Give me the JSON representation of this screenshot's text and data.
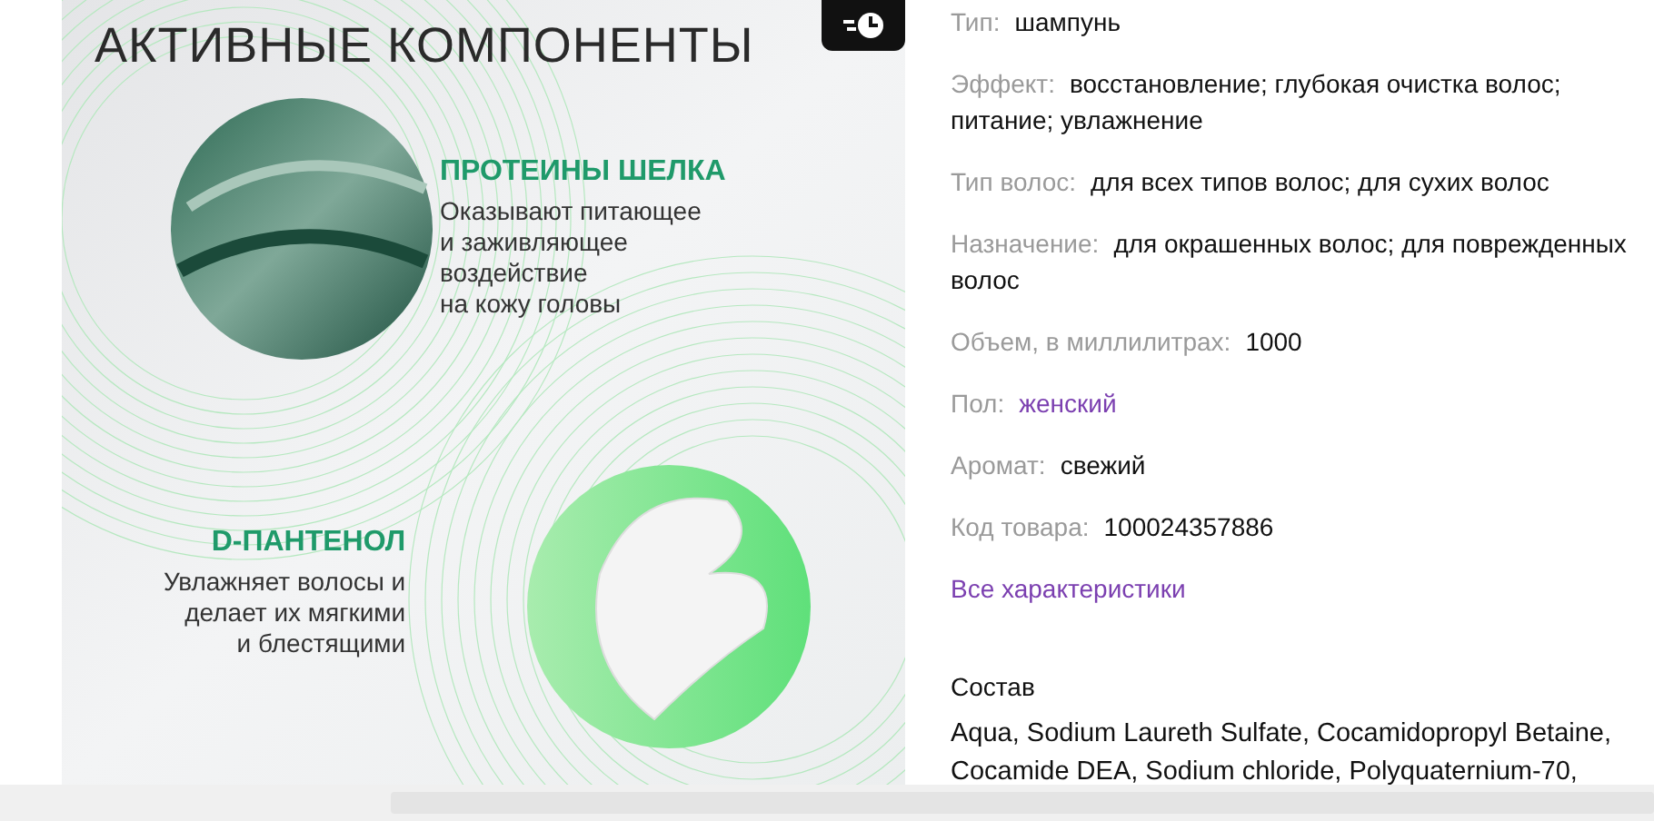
{
  "product_image": {
    "title": "АКТИВНЫЕ КОМПОНЕНТЫ",
    "blocks": [
      {
        "heading": "ПРОТЕИНЫ ШЕЛКА",
        "lines": [
          "Оказывают питающее",
          "и заживляющее",
          "воздействие",
          "на кожу головы"
        ]
      },
      {
        "heading": "D-ПАНТЕНОЛ",
        "lines": [
          "Увлажняет волосы и",
          "делает их мягкими",
          "и блестящими"
        ]
      }
    ]
  },
  "specs": [
    {
      "label": "Тип:",
      "value": "шампунь",
      "kind": "text"
    },
    {
      "label": "Эффект:",
      "value": "восстановление; глубокая очистка волос; питание; увлажнение",
      "kind": "text"
    },
    {
      "label": "Тип волос:",
      "value": "для всех типов волос; для сухих волос",
      "kind": "text"
    },
    {
      "label": "Назначение:",
      "value": "для окрашенных волос; для поврежденных волос",
      "kind": "text"
    },
    {
      "label": "Объем, в миллилитрах:",
      "value": "1000",
      "kind": "text"
    },
    {
      "label": "Пол:",
      "value": "женский",
      "kind": "link"
    },
    {
      "label": "Аромат:",
      "value": "свежий",
      "kind": "text"
    },
    {
      "label": "Код товара:",
      "value": "100024357886",
      "kind": "text"
    }
  ],
  "all_specs_link": "Все характеристики",
  "composition": {
    "title": "Состав",
    "text": "Aqua, Sodium Laureth Sulfate, Cocamidopropyl Betaine, Cocamide DEA, Sodium chloride, Polyquaternium-70,"
  }
}
